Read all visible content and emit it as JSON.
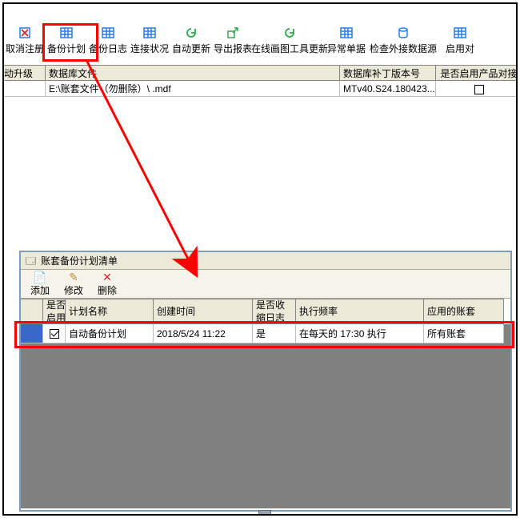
{
  "toolbar": {
    "items": [
      {
        "label": "取消注册",
        "icon": "unregister",
        "color": "#2a7be4"
      },
      {
        "label": "备份计划",
        "icon": "grid",
        "color": "#2a7be4"
      },
      {
        "label": "备份日志",
        "icon": "grid",
        "color": "#2a7be4"
      },
      {
        "label": "连接状况",
        "icon": "grid",
        "color": "#2a7be4"
      },
      {
        "label": "自动更新",
        "icon": "refresh",
        "color": "#2fa84f"
      },
      {
        "label": "导出报表",
        "icon": "export",
        "color": "#2fa84f"
      },
      {
        "label": "在线画图工具更新",
        "icon": "refresh",
        "color": "#2fa84f",
        "wide": true
      },
      {
        "label": "异常单据",
        "icon": "grid",
        "color": "#2a7be4"
      },
      {
        "label": "检查外接数据源",
        "icon": "db",
        "color": "#2a7be4",
        "wide": true
      },
      {
        "label": "启用对",
        "icon": "grid",
        "color": "#2a7be4"
      }
    ]
  },
  "top_table": {
    "headers": {
      "col0": "动升级",
      "col1": "数据库文件",
      "col2": "数据库补丁版本号",
      "col3": "是否启用产品对接"
    },
    "row": {
      "path": "E:\\账套文件（勿删除）\\               .mdf",
      "version": "MTv40.S24.180423...",
      "checked": false
    }
  },
  "sub_window": {
    "title": "账套备份计划清单",
    "actions": {
      "add": "添加",
      "edit": "修改",
      "delete": "删除"
    },
    "headers": {
      "enable": "是否\n启用",
      "name": "计划名称",
      "created": "创建时间",
      "rcv": "是否收\n缩日志",
      "freq": "执行频率",
      "scope": "应用的账套"
    },
    "row": {
      "enabled": true,
      "name": "自动备份计划",
      "created": "2018/5/24 11:22",
      "rcv": "是",
      "freq": "在每天的 17:30 执行",
      "scope": "所有账套"
    }
  }
}
